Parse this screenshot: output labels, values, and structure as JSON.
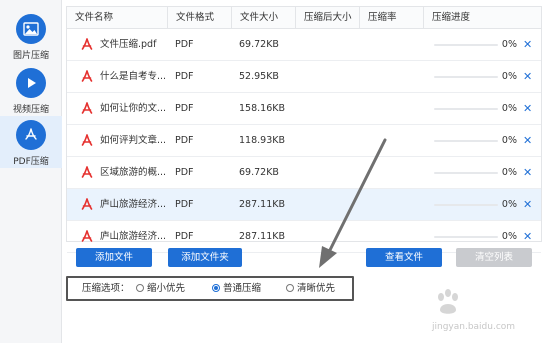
{
  "sidebar": {
    "items": [
      {
        "label": "图片压缩",
        "icon": "image-icon"
      },
      {
        "label": "视频压缩",
        "icon": "play-icon"
      },
      {
        "label": "PDF压缩",
        "icon": "pdf-logo-icon",
        "active": true
      }
    ]
  },
  "table": {
    "headers": [
      "文件名称",
      "文件格式",
      "文件大小",
      "压缩后大小",
      "压缩率",
      "压缩进度"
    ],
    "rows": [
      {
        "name": "文件压缩.pdf",
        "format": "PDF",
        "size": "69.72KB",
        "progress": "0%",
        "progress_value": 0
      },
      {
        "name": "什么是自考专...",
        "format": "PDF",
        "size": "52.95KB",
        "progress": "0%",
        "progress_value": 0
      },
      {
        "name": "如何让你的文...",
        "format": "PDF",
        "size": "158.16KB",
        "progress": "0%",
        "progress_value": 0
      },
      {
        "name": "如何评判文章...",
        "format": "PDF",
        "size": "118.93KB",
        "progress": "0%",
        "progress_value": 0
      },
      {
        "name": "区域旅游的概...",
        "format": "PDF",
        "size": "69.72KB",
        "progress": "0%",
        "progress_value": 0
      },
      {
        "name": "庐山旅游经济...",
        "format": "PDF",
        "size": "287.11KB",
        "progress": "0%",
        "progress_value": 0,
        "selected": true
      },
      {
        "name": "庐山旅游经济...",
        "format": "PDF",
        "size": "287.11KB",
        "progress": "0%",
        "progress_value": 0
      }
    ],
    "delete_symbol": "✕"
  },
  "buttons": {
    "add_file": "添加文件",
    "add_folder": "添加文件夹",
    "view_file": "查看文件",
    "clear_list": "清空列表"
  },
  "options": {
    "title": "压缩选项：",
    "choices": [
      {
        "label": "缩小优先",
        "checked": false
      },
      {
        "label": "普通压缩",
        "checked": true
      },
      {
        "label": "清晰优先",
        "checked": false
      }
    ]
  },
  "watermark": {
    "text": "jingyan.baidu.com"
  },
  "colors": {
    "accent": "#1f6fd6",
    "pdf_red": "#e5312f",
    "selected_row": "#eaf3fd",
    "annotation": "#707070"
  }
}
